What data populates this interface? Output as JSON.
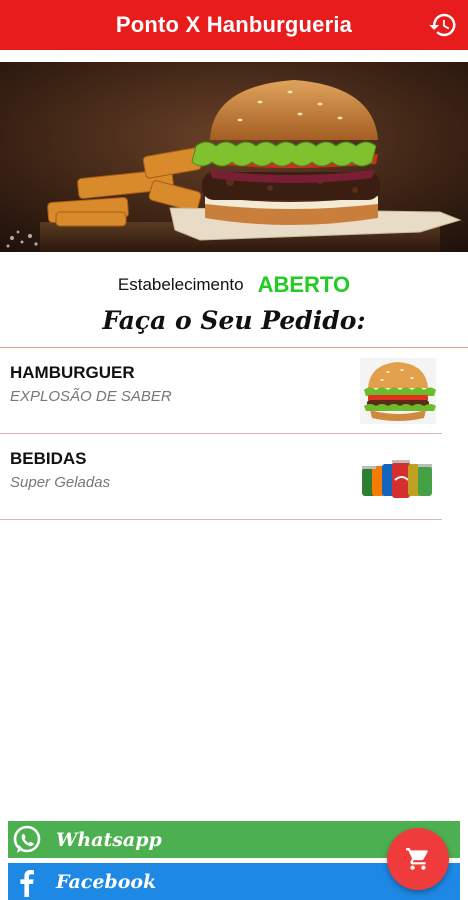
{
  "app_bar": {
    "title": "Ponto X Hanburgueria",
    "history_icon": "history-icon"
  },
  "hero": {
    "image": "burger-and-fries-photo"
  },
  "status": {
    "label": "Estabelecimento",
    "value": "ABERTO",
    "value_color": "#22cc22"
  },
  "order_title": "Faça o Seu Pedido:",
  "menu": {
    "items": [
      {
        "name": "HAMBURGUER",
        "description": "EXPLOSÃO DE SABER",
        "icon": "burger-icon"
      },
      {
        "name": "BEBIDAS",
        "description": "Super Geladas",
        "icon": "soda-cans-icon"
      }
    ]
  },
  "social": {
    "whatsapp_label": "Whatsapp",
    "facebook_label": "Facebook",
    "whatsapp_color": "#4caf50",
    "facebook_color": "#1e88e5"
  },
  "fab": {
    "icon": "cart-icon",
    "color": "#ef3b3b"
  },
  "colors": {
    "brand": "#e81c1c"
  }
}
